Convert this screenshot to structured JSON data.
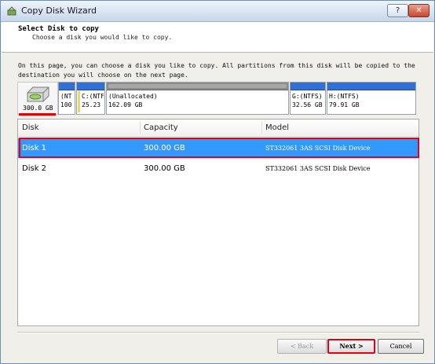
{
  "window": {
    "title": "Copy Disk Wizard",
    "help_label": "?",
    "close_label": "✕"
  },
  "header": {
    "title": "Select Disk to copy",
    "subtitle": "Choose a disk you would like to copy."
  },
  "intro_text": "On this page, you can choose a disk you like to copy. All partitions from this disk will be copied to the destination you will choose on the next page.",
  "disk_map": {
    "disk_size": "300.0 GB",
    "partitions": [
      {
        "line1": "(NT",
        "line2": "100",
        "style": "blue"
      },
      {
        "line1": "C:(NTF",
        "line2": "25.23",
        "style": "blue-used"
      },
      {
        "line1": "(Unallocated)",
        "line2": "162.09 GB",
        "style": "gray"
      },
      {
        "line1": "G:(NTFS)",
        "line2": "32.56 GB",
        "style": "blue"
      },
      {
        "line1": "H:(NTFS)",
        "line2": "79.91 GB",
        "style": "blue"
      }
    ]
  },
  "table": {
    "columns": [
      "Disk",
      "Capacity",
      "Model"
    ],
    "rows": [
      {
        "disk": "Disk 1",
        "capacity": "300.00 GB",
        "model": "ST332061 3AS SCSI Disk Device",
        "selected": true
      },
      {
        "disk": "Disk 2",
        "capacity": "300.00 GB",
        "model": "ST332061 3AS SCSI Disk Device",
        "selected": false
      }
    ]
  },
  "buttons": {
    "back": "< Back",
    "next": "Next >",
    "cancel": "Cancel"
  },
  "colors": {
    "selection": "#3399ff",
    "highlight": "#e0001b",
    "partition_bar": "#2f6fd6"
  }
}
